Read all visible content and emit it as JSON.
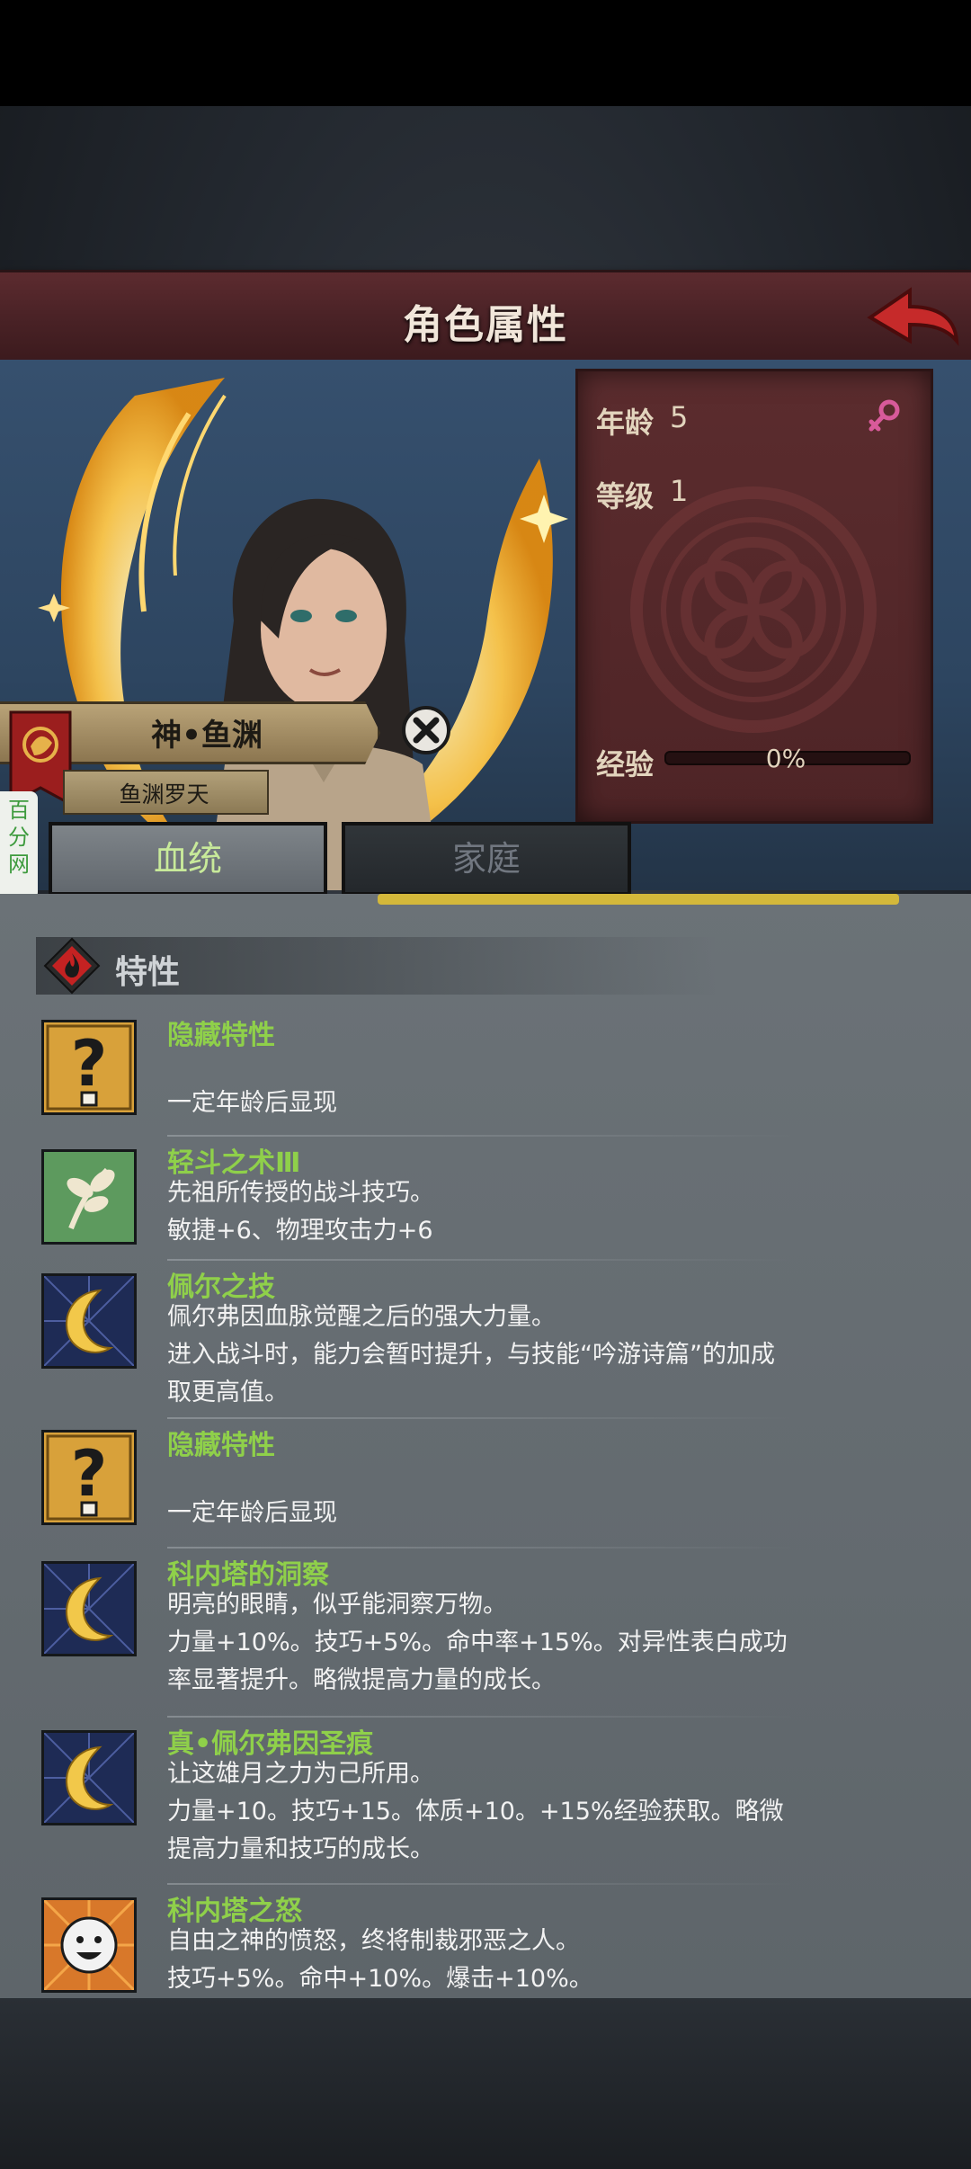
{
  "header": {
    "title": "角色属性"
  },
  "character": {
    "name": "神•鱼渊",
    "title": "鱼渊罗天"
  },
  "stats": {
    "age_label": "年龄",
    "age_value": "5",
    "level_label": "等级",
    "level_value": "1",
    "exp_label": "经验",
    "exp_value": "0%",
    "exp_fraction": 0.0
  },
  "watermark": {
    "text": "百分网"
  },
  "tabs": [
    {
      "label": "血统",
      "active": true
    },
    {
      "label": "家庭",
      "active": false
    }
  ],
  "section": {
    "title": "特性"
  },
  "traits": [
    {
      "icon": "question-icon",
      "name": "隐藏特性",
      "desc": "\n一定年龄后显现"
    },
    {
      "icon": "leaf-icon",
      "name": "轻斗之术Ⅲ",
      "desc": "先祖所传授的战斗技巧。\n敏捷+6、物理攻击力+6"
    },
    {
      "icon": "moon-icon",
      "name": "佩尔之技",
      "desc": "佩尔弗因血脉觉醒之后的强大力量。\n进入战斗时，能力会暂时提升，与技能“吟游诗篇”的加成\n取更高值。"
    },
    {
      "icon": "question-icon",
      "name": "隐藏特性",
      "desc": "\n一定年龄后显现"
    },
    {
      "icon": "moon-icon",
      "name": "科内塔的洞察",
      "desc": "明亮的眼睛，似乎能洞察万物。\n力量+10%。技巧+5%。命中率+15%。对异性表白成功\n率显著提升。略微提高力量的成长。"
    },
    {
      "icon": "moon-icon",
      "name": "真•佩尔弗因圣痕",
      "desc": "让这雄月之力为己所用。\n力量+10。技巧+15。体质+10。+15%经验获取。略微\n提高力量和技巧的成长。"
    },
    {
      "icon": "sun-face-icon",
      "name": "科内塔之怒",
      "desc": "自由之神的愤怒，终将制裁邪恶之人。\n技巧+5%。命中+10%。爆击+10%。"
    }
  ],
  "colors": {
    "trait_name": "#8fd04a",
    "header_bg": "#4a2226",
    "tab_active_text": "#c8ea9a"
  }
}
